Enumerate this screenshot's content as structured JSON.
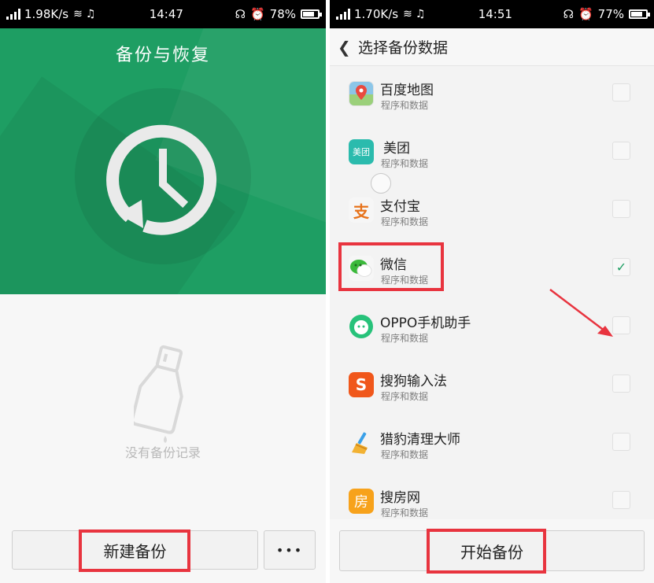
{
  "left_screen": {
    "status": {
      "speed": "1.98K/s",
      "time": "14:47",
      "battery": "78%",
      "battery_level": 0.78
    },
    "title": "备份与恢复",
    "empty_text": "没有备份记录",
    "new_backup_label": "新建备份",
    "more_label": "•••"
  },
  "right_screen": {
    "status": {
      "speed": "1.70K/s",
      "time": "14:51",
      "battery": "77%",
      "battery_level": 0.77
    },
    "back_icon": "chevron-left-icon",
    "title": "选择备份数据",
    "apps": [
      {
        "name": "百度地图",
        "sub": "程序和数据",
        "checked": false,
        "icon": "baidu-map-icon",
        "color": "#e94a3f"
      },
      {
        "name": "美团",
        "sub": "程序和数据",
        "checked": false,
        "icon": "meituan-icon",
        "icon_text": "美团",
        "color": "#2bbbad"
      },
      {
        "name": "支付宝",
        "sub": "程序和数据",
        "checked": false,
        "icon": "alipay-icon",
        "icon_text": "支",
        "color": "#f0f0f0"
      },
      {
        "name": "微信",
        "sub": "程序和数据",
        "checked": true,
        "icon": "wechat-icon",
        "color": "#3bb93b"
      },
      {
        "name": "OPPO手机助手",
        "sub": "程序和数据",
        "checked": false,
        "icon": "oppo-assistant-icon",
        "color": "#27c27a"
      },
      {
        "name": "搜狗输入法",
        "sub": "程序和数据",
        "checked": false,
        "icon": "sogou-input-icon",
        "icon_text": "S",
        "color": "#f0571b"
      },
      {
        "name": "猎豹清理大师",
        "sub": "程序和数据",
        "checked": false,
        "icon": "cleaner-broom-icon",
        "color": "#3aa0e8"
      },
      {
        "name": "搜房网",
        "sub": "程序和数据",
        "checked": false,
        "icon": "soufang-icon",
        "icon_text": "房",
        "color": "#f7a21b"
      }
    ],
    "start_backup_label": "开始备份",
    "check_mark": "✓"
  },
  "colors": {
    "accent_green": "#1e9e63",
    "highlight_red": "#e8343f"
  }
}
